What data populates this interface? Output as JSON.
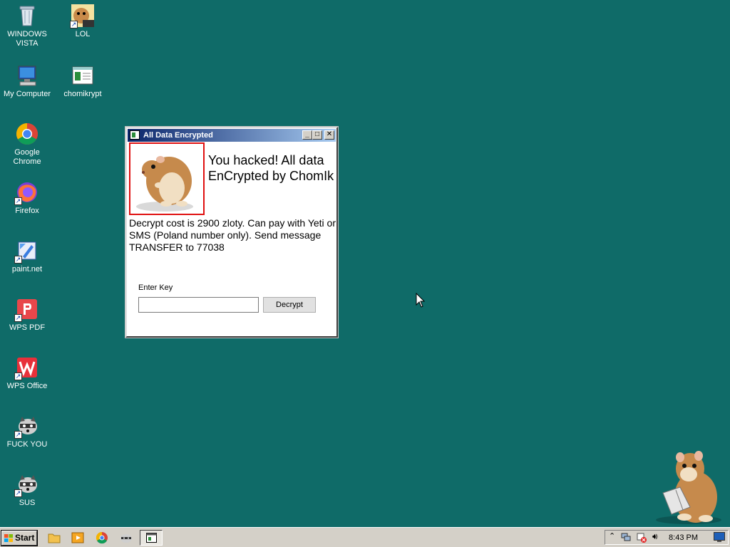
{
  "desktop": {
    "icons": [
      {
        "label": "WINDOWS VISTA",
        "icon": "recycle-bin-icon"
      },
      {
        "label": "LOL",
        "icon": "hamster-box-icon"
      },
      {
        "label": "My Computer",
        "icon": "computer-icon"
      },
      {
        "label": "chomikrypt",
        "icon": "program-window-icon"
      },
      {
        "label": "Google Chrome",
        "icon": "chrome-icon"
      },
      {
        "label": "Firefox",
        "icon": "firefox-icon"
      },
      {
        "label": "paint.net",
        "icon": "paintnet-icon"
      },
      {
        "label": "WPS PDF",
        "icon": "wps-pdf-icon"
      },
      {
        "label": "WPS Office",
        "icon": "wps-office-icon"
      },
      {
        "label": "FUCK YOU",
        "icon": "raccoon-icon"
      },
      {
        "label": "SUS",
        "icon": "raccoon-icon"
      }
    ]
  },
  "window": {
    "title": "All Data Encrypted",
    "headline": "You hacked! All data EnCrypted by ChomIk",
    "message": "Decrypt cost is 2900 zloty. Can pay with Yeti or SMS (Poland number only). Send message TRANSFER to 77038",
    "key_label": "Enter Key",
    "key_value": "",
    "decrypt_label": "Decrypt",
    "minimize": "_",
    "maximize": "□",
    "close": "✕"
  },
  "taskbar": {
    "start_label": "Start",
    "clock": "8:43 PM"
  },
  "colors": {
    "desktop": "#0f6b68",
    "title_gradient_start": "#0a246a",
    "title_gradient_end": "#a6caf0",
    "image_border": "#e01010"
  }
}
